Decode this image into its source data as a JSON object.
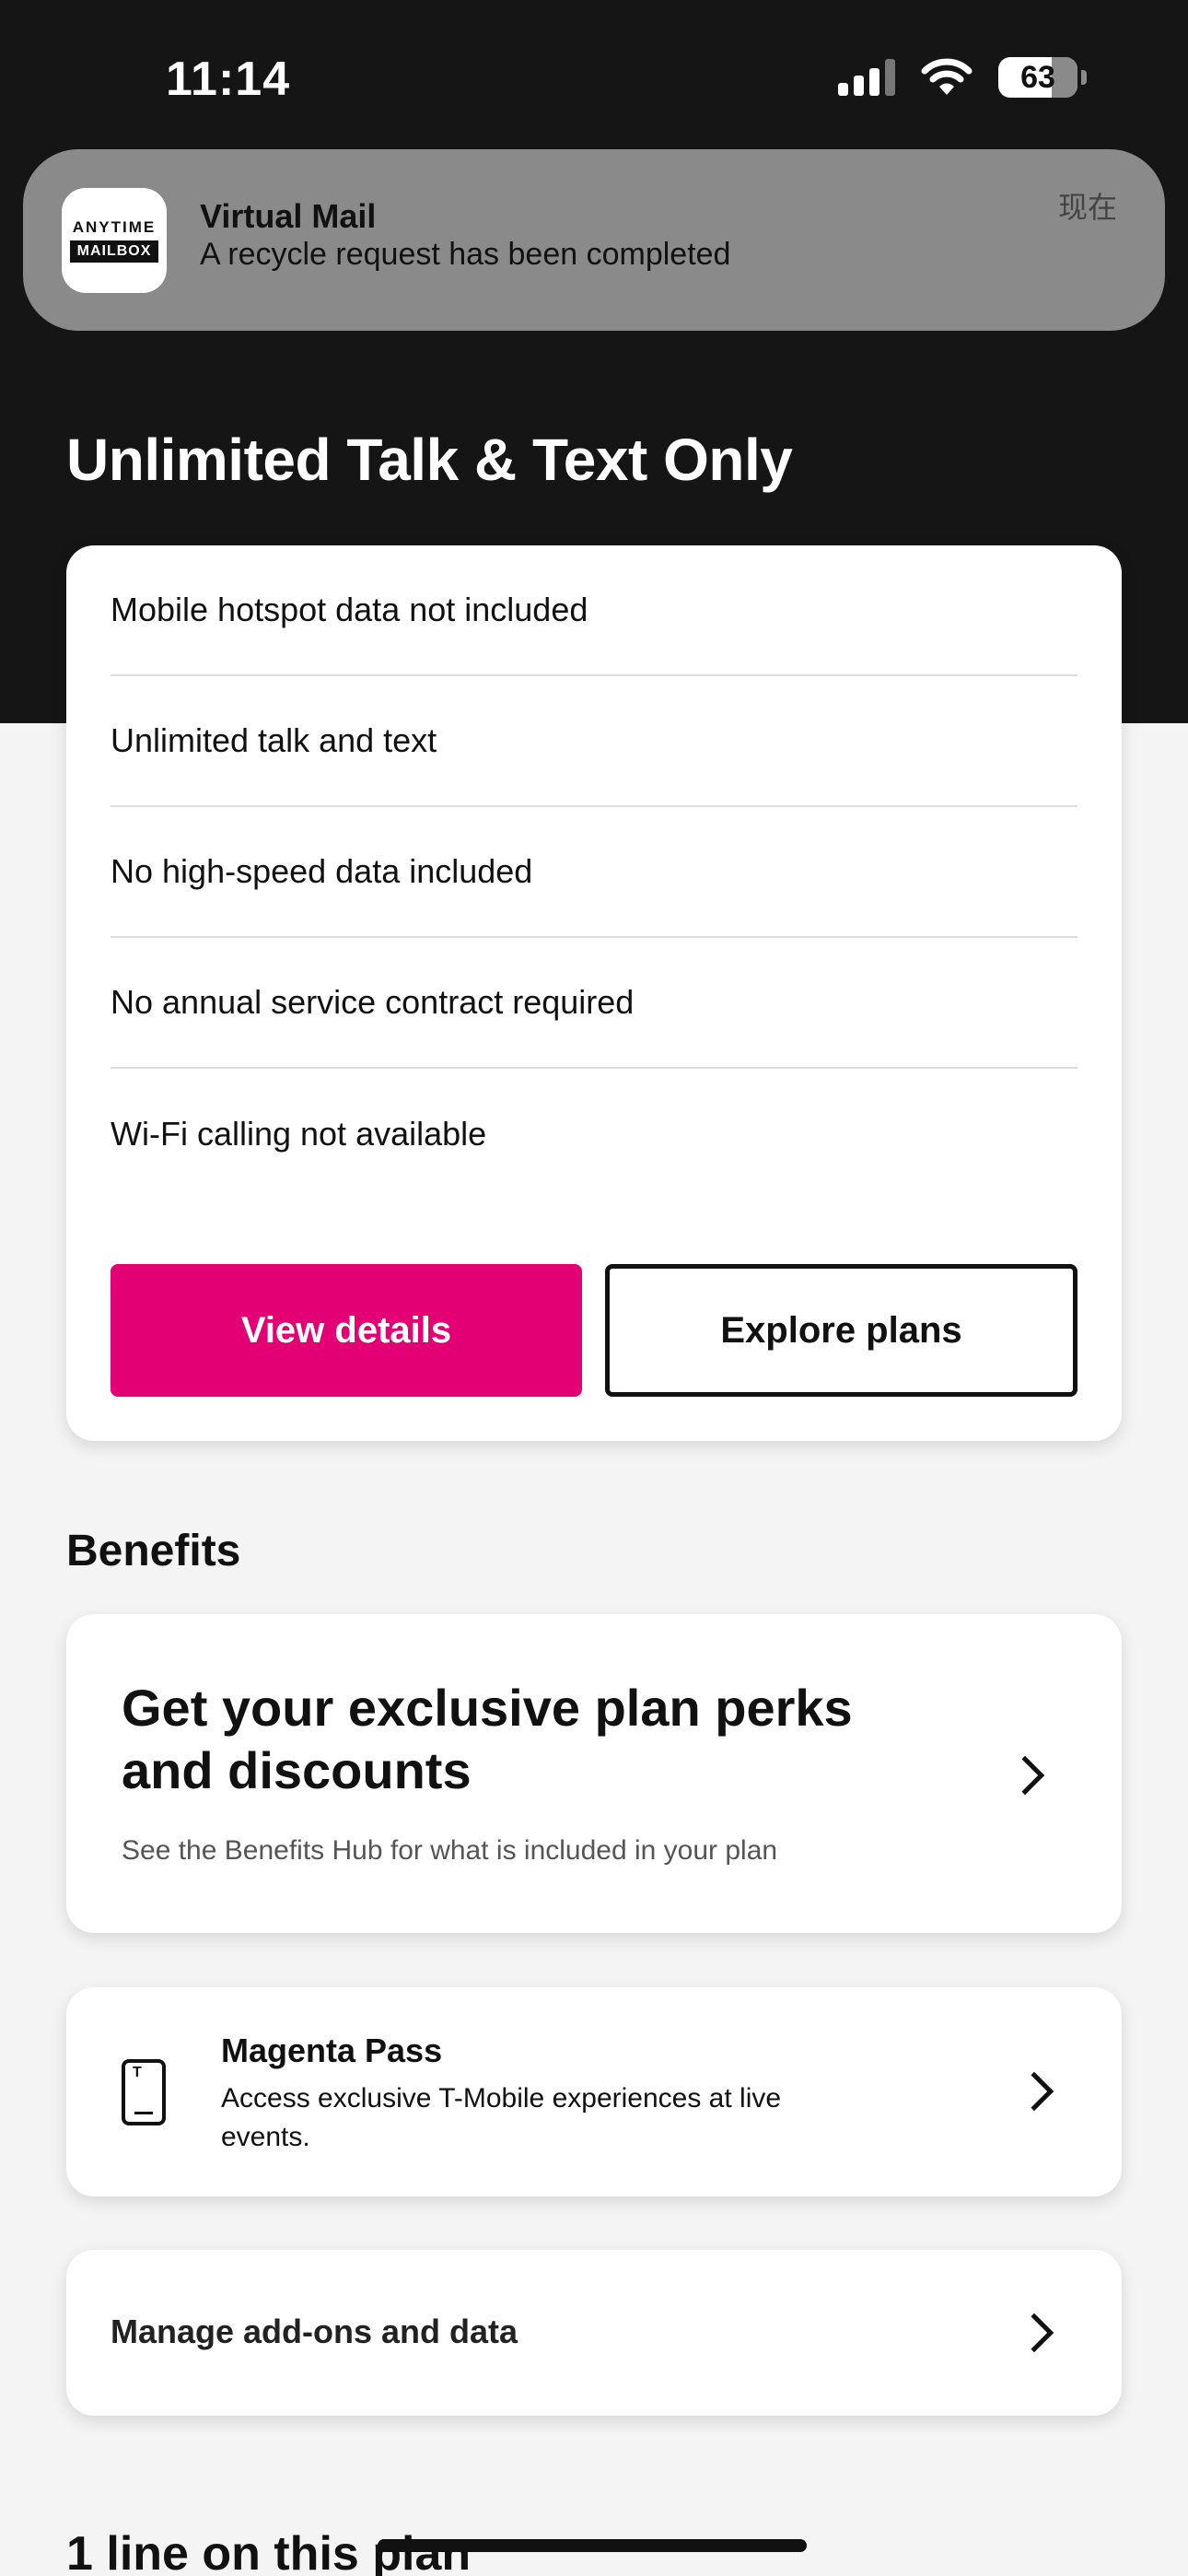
{
  "status_bar": {
    "time": "11:14",
    "battery": "63"
  },
  "notification": {
    "app_icon_line1": "ANYTIME",
    "app_icon_line2": "MAILBOX",
    "title": "Virtual Mail",
    "body": "A recycle request has been completed",
    "time": "现在"
  },
  "plan": {
    "title": "Unlimited Talk & Text Only",
    "features": [
      "Mobile hotspot data not included",
      "Unlimited talk and text",
      "No high-speed data included",
      "No annual service contract required",
      "Wi-Fi calling not available"
    ],
    "view_details": "View details",
    "explore_plans": "Explore plans"
  },
  "benefits": {
    "heading": "Benefits",
    "perks_title": "Get your exclusive plan perks and discounts",
    "perks_sub": "See the Benefits Hub for what is included in your plan",
    "pass_title": "Magenta Pass",
    "pass_desc": "Access exclusive T-Mobile experiences at live events.",
    "pass_icon_glyph": "T"
  },
  "addons": {
    "label": "Manage add-ons and data"
  },
  "lines": {
    "heading": "1 line on this plan"
  },
  "colors": {
    "brand": "#e20074",
    "dark": "#151515"
  }
}
